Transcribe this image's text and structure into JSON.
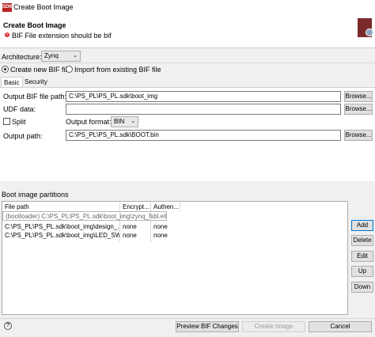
{
  "window": {
    "title": "Create Boot Image",
    "app_icon_text": "SDK"
  },
  "header": {
    "title": "Create Boot Image",
    "error": "BIF File extension should be bif"
  },
  "architecture": {
    "label": "Architecture:",
    "value": "Zynq"
  },
  "mode": {
    "create_label": "Create new BIF file",
    "import_label": "Import from existing BIF file",
    "selected": "create"
  },
  "tabs": [
    "Basic",
    "Security"
  ],
  "form": {
    "output_bif_label": "Output BIF file path:",
    "output_bif_value": "C:\\PS_PL\\PS_PL.sdk\\boot_img",
    "udf_label": "UDF data:",
    "udf_value": "",
    "split_label": "Split",
    "format_label": "Output format:",
    "format_value": "BIN",
    "output_path_label": "Output path:",
    "output_path_value": "C:\\PS_PL\\PS_PL.sdk\\BOOT.bin",
    "browse_label": "Browse..."
  },
  "partitions": {
    "title": "Boot image partitions",
    "columns": [
      "File path",
      "Encrypt...",
      "Authen..."
    ],
    "rows": [
      [
        "(bootloader) C:\\PS_PL\\PS_PL.sdk\\boot_img\\zynq_fsbl.elf",
        "",
        ""
      ],
      [
        "C:\\PS_PL\\PS_PL.sdk\\boot_img\\design_...",
        "none",
        "none"
      ],
      [
        "C:\\PS_PL\\PS_PL.sdk\\boot_img\\LED_SW...",
        "none",
        "none"
      ]
    ],
    "buttons": {
      "add": "Add",
      "delete": "Delete",
      "edit": "Edit",
      "up": "Up",
      "down": "Down"
    }
  },
  "footer": {
    "help_icon": "?",
    "preview": "Preview BIF Changes",
    "create": "Create Image",
    "cancel": "Cancel"
  }
}
